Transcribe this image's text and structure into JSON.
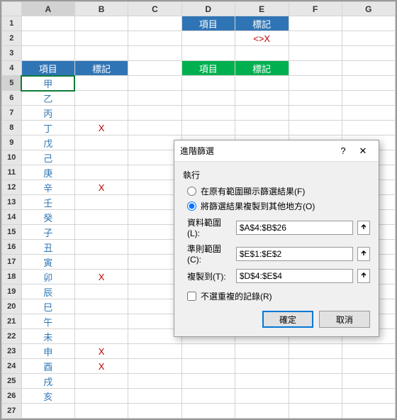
{
  "columns": [
    "A",
    "B",
    "C",
    "D",
    "E",
    "F",
    "G"
  ],
  "rows": [
    "1",
    "2",
    "3",
    "4",
    "5",
    "6",
    "7",
    "8",
    "9",
    "10",
    "11",
    "12",
    "13",
    "14",
    "15",
    "16",
    "17",
    "18",
    "19",
    "20",
    "21",
    "22",
    "23",
    "24",
    "25",
    "26",
    "27"
  ],
  "hdr_item": "項目",
  "hdr_mark": "標記",
  "criteria_value": "<>X",
  "items": [
    "甲",
    "乙",
    "丙",
    "丁",
    "戊",
    "己",
    "庚",
    "辛",
    "壬",
    "癸",
    "子",
    "丑",
    "寅",
    "卯",
    "辰",
    "巳",
    "午",
    "未",
    "申",
    "酉",
    "戌",
    "亥"
  ],
  "marks": {
    "8": "X",
    "12": "X",
    "18": "X",
    "23": "X",
    "24": "X"
  },
  "dialog": {
    "title": "進階篩選",
    "help": "?",
    "close": "✕",
    "section_execute": "執行",
    "radio_inplace": "在原有範圍顯示篩選結果(F)",
    "radio_copy": "將篩選結果複製到其他地方(O)",
    "label_list": "資料範圍(L):",
    "val_list": "$A$4:$B$26",
    "label_criteria": "準則範圍(C):",
    "val_criteria": "$E$1:$E$2",
    "label_copyto": "複製到(T):",
    "val_copyto": "$D$4:$E$4",
    "chk_unique": "不選重複的記錄(R)",
    "btn_ok": "確定",
    "btn_cancel": "取消"
  },
  "chart_data": {
    "type": "table",
    "title": "Advanced Filter setup",
    "data_range": "$A$4:$B$26",
    "criteria_range": "$E$1:$E$2",
    "copy_to": "$D$4:$E$4",
    "criteria": {
      "標記": "<>X"
    },
    "records": [
      {
        "項目": "甲",
        "標記": ""
      },
      {
        "項目": "乙",
        "標記": ""
      },
      {
        "項目": "丙",
        "標記": ""
      },
      {
        "項目": "丁",
        "標記": "X"
      },
      {
        "項目": "戊",
        "標記": ""
      },
      {
        "項目": "己",
        "標記": ""
      },
      {
        "項目": "庚",
        "標記": ""
      },
      {
        "項目": "辛",
        "標記": "X"
      },
      {
        "項目": "壬",
        "標記": ""
      },
      {
        "項目": "癸",
        "標記": ""
      },
      {
        "項目": "子",
        "標記": ""
      },
      {
        "項目": "丑",
        "標記": ""
      },
      {
        "項目": "寅",
        "標記": ""
      },
      {
        "項目": "卯",
        "標記": "X"
      },
      {
        "項目": "辰",
        "標記": ""
      },
      {
        "項目": "巳",
        "標記": ""
      },
      {
        "項目": "午",
        "標記": ""
      },
      {
        "項目": "未",
        "標記": ""
      },
      {
        "項目": "申",
        "標記": "X"
      },
      {
        "項目": "酉",
        "標記": "X"
      },
      {
        "項目": "戌",
        "標記": ""
      },
      {
        "項目": "亥",
        "標記": ""
      }
    ]
  }
}
